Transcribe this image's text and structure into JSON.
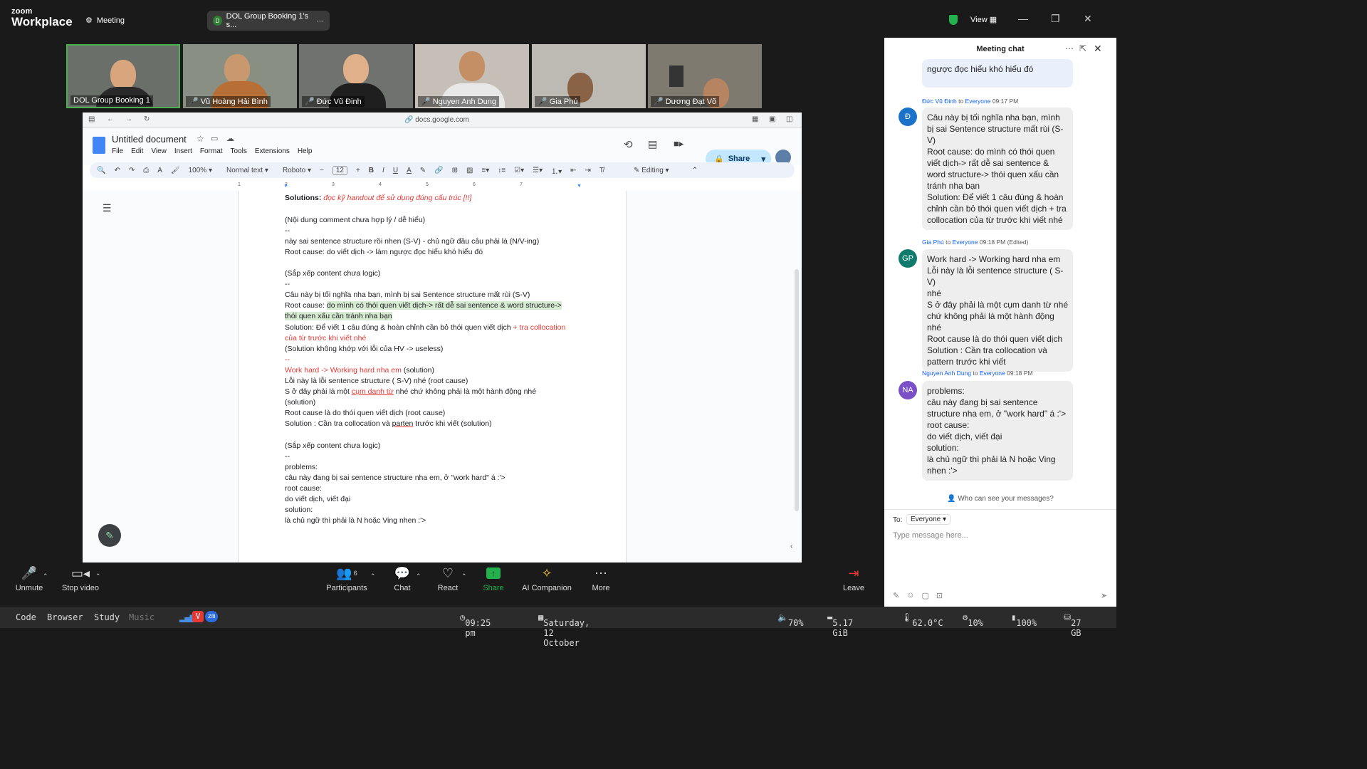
{
  "app": {
    "brand_small": "zoom",
    "brand_big": "Workplace",
    "meeting_label": "Meeting",
    "tab_title": "DOL Group Booking 1's s...",
    "tab_initial": "D",
    "view_label": "View"
  },
  "participants": [
    {
      "name": "DOL Group Booking 1",
      "muted": false
    },
    {
      "name": "Vũ Hoàng Hải Bình",
      "muted": true
    },
    {
      "name": "Đức Vũ Đinh",
      "muted": true
    },
    {
      "name": "Nguyen Anh Dung",
      "muted": true
    },
    {
      "name": "Gia Phú",
      "muted": true
    },
    {
      "name": "Dương Đạt Võ",
      "muted": true
    }
  ],
  "browser": {
    "url": "docs.google.com"
  },
  "doc": {
    "title": "Untitled document",
    "menu": [
      "File",
      "Edit",
      "View",
      "Insert",
      "Format",
      "Tools",
      "Extensions",
      "Help"
    ],
    "share_label": "Share",
    "zoom": "100%",
    "style": "Normal text",
    "font": "Roboto",
    "font_size": "12",
    "mode": "Editing",
    "ruler_ticks": [
      "1",
      "2",
      "3",
      "4",
      "5",
      "6",
      "7"
    ],
    "lines": [
      "Solutions:",
      "đọc kỹ handout để sử dụng đúng cấu trúc [!!]",
      "(Nội dung comment chưa hợp lý / dễ hiểu)",
      "--",
      "này sai sentence structure rồi nhen (S-V) - chủ ngữ đầu câu phải là (N/V-ing)",
      "Root cause: do viết dịch -> làm ngược đọc hiểu khó hiểu đó",
      "(Sắp xếp content chưa logic)",
      "--",
      "Câu này bị tối nghĩa nha bạn, mình bị sai Sentence structure mất rùi (S-V)",
      "Root cause: ",
      "do mình có thói quen viết dịch-> rất dễ sai sentence & word structure->",
      "thói quen xấu cần tránh nha bạn",
      "Solution: Để viết 1 câu đúng & hoàn chỉnh cần bỏ thói quen viết dịch",
      " + tra collocation",
      "của từ trước khi viết nhé",
      "(Solution không khớp với lỗi của HV -> useless)",
      "--",
      "Work hard -> Working hard nha em",
      " (solution)",
      "Lỗi này là lỗi sentence structure ( S-V) nhé (root cause)",
      "S ở đây phải là một ",
      "cụm danh từ",
      " nhé chứ không phải là một hành động nhé",
      "(solution)",
      "Root cause là do thói quen viết dịch (root cause)",
      "Solution : Cần tra collocation và ",
      "parten",
      " trước khi viết (solution)",
      "(Sắp xếp content chưa logic)",
      "--",
      "problems:",
      "câu này đang bị sai sentence structure nha em, ở \"work hard\" á :'>",
      "root cause:",
      "do viết dịch, viết đại",
      "solution:",
      "là chủ ngữ thì phải là N hoặc Ving nhen :'>"
    ]
  },
  "controls": {
    "unmute": "Unmute",
    "stop_video": "Stop video",
    "participants": "Participants",
    "participants_count": "6",
    "chat": "Chat",
    "react": "React",
    "share": "Share",
    "ai": "AI Companion",
    "more": "More",
    "leave": "Leave"
  },
  "chat": {
    "title": "Meeting chat",
    "prev_tail": "ngược đọc hiểu khó hiểu đó",
    "messages": [
      {
        "initials": "Đ",
        "sender": "Đức Vũ Đinh",
        "to": "to",
        "target": "Everyone",
        "time": "09:17 PM",
        "text": [
          "Câu này bị tối nghĩa nha bạn, mình",
          "bị sai Sentence structure mất rùi (S-",
          "V)",
          "Root cause: do mình có thói quen",
          "viết dịch-> rất dễ sai sentence &",
          "word structure-> thói quen xấu cần",
          "tránh nha bạn",
          "Solution: Để viết 1 câu đúng & hoàn",
          "chỉnh cần bỏ thói quen viết dịch + tra",
          "collocation của từ trước khi viết nhé"
        ]
      },
      {
        "initials": "GP",
        "sender": "Gia Phú",
        "to": "to",
        "target": "Everyone",
        "time": "09:18 PM (Edited)",
        "text": [
          "Work hard -> Working hard nha em",
          "Lỗi này là lỗi sentence structure ( S-V)",
          "nhé",
          "S ở đây phải là một cụm danh từ nhé",
          "chứ không phải là một hành động",
          "nhé",
          "Root cause là do thói quen viết dịch",
          "Solution : Cần tra collocation và",
          "pattern trước khi viết"
        ]
      },
      {
        "initials": "NA",
        "sender": "Nguyen Anh Dung",
        "to": "to",
        "target": "Everyone",
        "time": "09:18 PM",
        "text": [
          "problems:",
          "câu này đang bị sai sentence",
          "structure nha em, ở \"work hard\" á :'>",
          "root cause:",
          "do viết dịch, viết đại",
          "solution:",
          "là chủ ngữ thì phải là N hoặc Ving",
          "nhen :'>"
        ]
      }
    ],
    "who_can_see": "Who can see your messages?",
    "to_label": "To:",
    "to_value": "Everyone",
    "placeholder": "Type message here..."
  },
  "taskbar": {
    "workspaces": [
      "Code",
      "Browser",
      "Study",
      "Music"
    ],
    "time": "09:25 pm",
    "date": "Saturday, 12 October",
    "volume": "70%",
    "memory": "5.17 GiB",
    "temp": "62.0°C",
    "cpu": "10%",
    "battery": "100%",
    "disk": "27 GB"
  },
  "colors": {
    "accent": "#0b5cff",
    "share_green": "#22b14c",
    "doc_red": "#e53935",
    "active_tile": "#4caf50"
  }
}
